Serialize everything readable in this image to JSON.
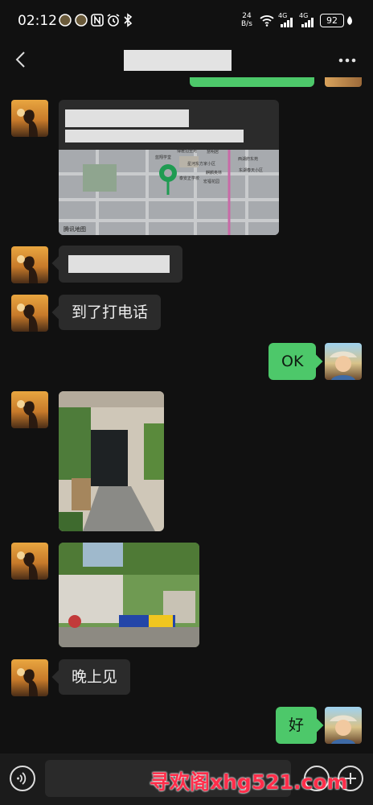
{
  "status_bar": {
    "time": "02:12",
    "net_speed_top": "24",
    "net_speed_bottom": "B/s",
    "signal1_label": "4G",
    "signal2_label": "4G",
    "battery": "92"
  },
  "header": {
    "back_icon": "chevron-left-icon",
    "more_icon": "ellipsis-icon"
  },
  "messages": [
    {
      "type": "location",
      "from": "contact",
      "map_credit": "腾讯地图"
    },
    {
      "type": "text",
      "from": "contact",
      "text": ""
    },
    {
      "type": "text",
      "from": "contact",
      "text": "到了打电话"
    },
    {
      "type": "text",
      "from": "me",
      "text": "OK"
    },
    {
      "type": "image",
      "from": "contact"
    },
    {
      "type": "image",
      "from": "contact"
    },
    {
      "type": "text",
      "from": "contact",
      "text": "晚上见"
    },
    {
      "type": "text",
      "from": "me",
      "text": "好"
    }
  ],
  "map_labels": [
    "博雅泊至苑",
    "蓝翔学堂",
    "星河东方家小区",
    "慧明居",
    "西湖府东苑",
    "东湖春天小区",
    "麒麟奥林",
    "泰安正学校",
    "宏福花园"
  ],
  "input": {
    "voice_icon": "voice-icon",
    "add_icon": "plus-icon"
  },
  "watermark": "寻欢阁xhg521.com",
  "colors": {
    "background": "#111111",
    "my_bubble": "#4dc86a",
    "their_bubble": "#2b2b2b",
    "watermark": "#ff2d4a"
  }
}
